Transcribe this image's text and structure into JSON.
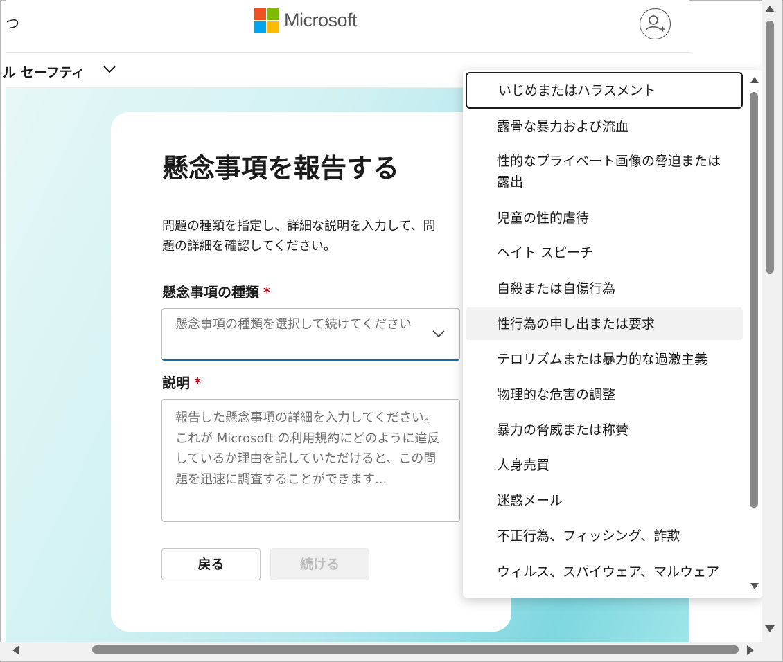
{
  "header": {
    "left_fragment": "つ",
    "brand": "Microsoft",
    "logo_colors": [
      "#f25022",
      "#7fba00",
      "#00a4ef",
      "#ffb900"
    ]
  },
  "nav": {
    "label": "ル セーフティ"
  },
  "card": {
    "title": "懸念事項を報告する",
    "description": "問題の種類を指定し、詳細な説明を入力して、問題の詳細を確認してください。",
    "type_field": {
      "label": "懸念事項の種類",
      "required_mark": "*",
      "placeholder": "懸念事項の種類を選択して続けてください"
    },
    "description_field": {
      "label": "説明",
      "required_mark": "*",
      "placeholder": "報告した懸念事項の詳細を入力してください。これが Microsoft の利用規約にどのように違反しているか理由を記していただけると、この問題を迅速に調査することができます..."
    },
    "back_button": "戻る",
    "continue_button": "続ける"
  },
  "dropdown": {
    "items": [
      {
        "label": "いじめまたはハラスメント",
        "state": "focused"
      },
      {
        "label": "露骨な暴力および流血",
        "state": ""
      },
      {
        "label": "性的なプライベート画像の脅迫または露出",
        "state": ""
      },
      {
        "label": "児童の性的虐待",
        "state": ""
      },
      {
        "label": "ヘイト スピーチ",
        "state": ""
      },
      {
        "label": "自殺または自傷行為",
        "state": ""
      },
      {
        "label": "性行為の申し出または要求",
        "state": "hover"
      },
      {
        "label": "テロリズムまたは暴力的な過激主義",
        "state": ""
      },
      {
        "label": "物理的な危害の調整",
        "state": ""
      },
      {
        "label": "暴力の脅威または称賛",
        "state": ""
      },
      {
        "label": "人身売買",
        "state": ""
      },
      {
        "label": "迷惑メール",
        "state": ""
      },
      {
        "label": "不正行為、フィッシング、詐欺",
        "state": ""
      },
      {
        "label": "ウィルス、スパイウェア、マルウェア",
        "state": ""
      }
    ]
  },
  "colors": {
    "accent": "#0f6cbd",
    "required": "#c50f1f",
    "placeholder": "#707070"
  }
}
